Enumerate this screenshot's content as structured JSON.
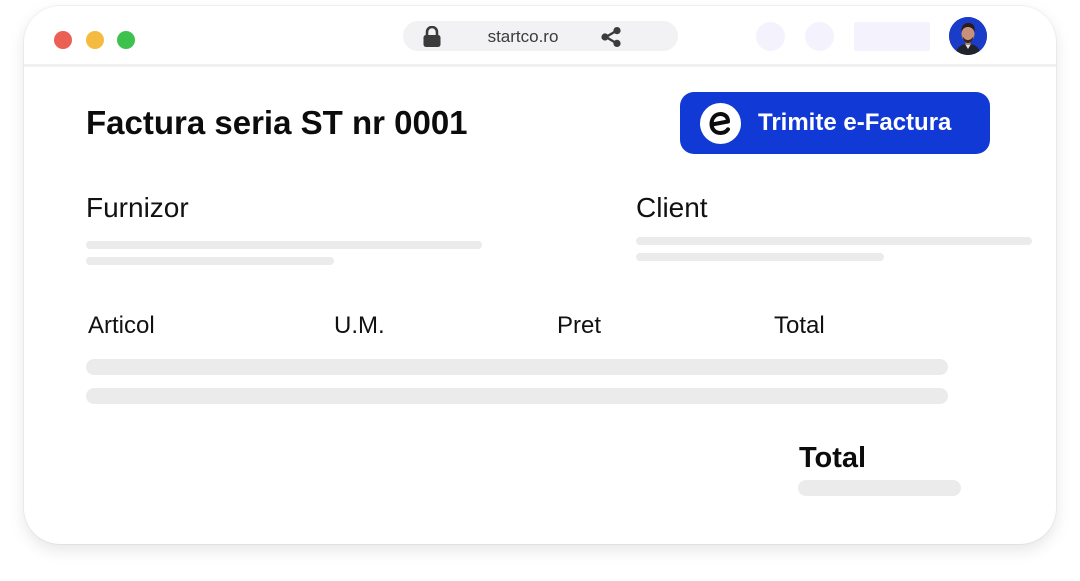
{
  "browser": {
    "url": "startco.ro",
    "colors": {
      "close": "#ec5f55",
      "minimize": "#f4bb40",
      "maximize": "#3fc14d"
    }
  },
  "invoice": {
    "title": "Factura seria ST nr 0001",
    "send_button_label": "Trimite e-Factura",
    "supplier_label": "Furnizor",
    "client_label": "Client",
    "columns": [
      "Articol",
      "U.M.",
      "Pret",
      "Total"
    ],
    "total_label": "Total"
  },
  "colors": {
    "accent": "#1139d6"
  },
  "icons": [
    "lock-icon",
    "share-icon",
    "e-factura-icon",
    "avatar"
  ]
}
